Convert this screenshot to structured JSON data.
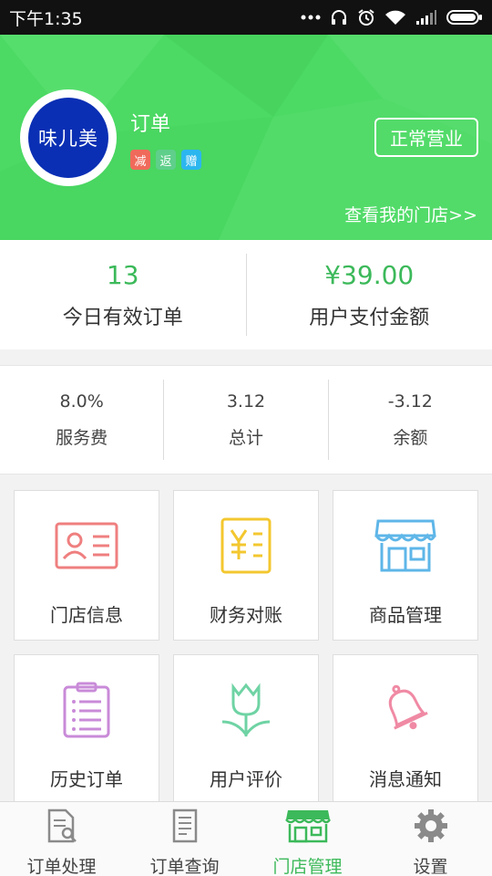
{
  "status_bar": {
    "time": "下午1:35"
  },
  "store": {
    "logo_text": "味儿美",
    "name": "订单",
    "tags": [
      "减",
      "返",
      "赠"
    ],
    "status_button": "正常营业",
    "view_store_link": "查看我的门店>>"
  },
  "summary": {
    "orders_today": {
      "value": "13",
      "label": "今日有效订单"
    },
    "user_paid": {
      "value": "¥39.00",
      "label": "用户支付金额"
    }
  },
  "fees": {
    "service_fee": {
      "value": "8.0%",
      "label": "服务费"
    },
    "total": {
      "value": "3.12",
      "label": "总计"
    },
    "balance": {
      "value": "-3.12",
      "label": "余额"
    }
  },
  "menu": {
    "store_info": "门店信息",
    "finance": "财务对账",
    "goods": "商品管理",
    "history_orders": "历史订单",
    "reviews": "用户评价",
    "notifications": "消息通知"
  },
  "tabs": {
    "order_process": "订单处理",
    "order_query": "订单查询",
    "store_manage": "门店管理",
    "settings": "设置"
  },
  "colors": {
    "brand_green": "#4cd964",
    "accent_green": "#3cb95a",
    "logo_blue": "#0a2fb4"
  }
}
